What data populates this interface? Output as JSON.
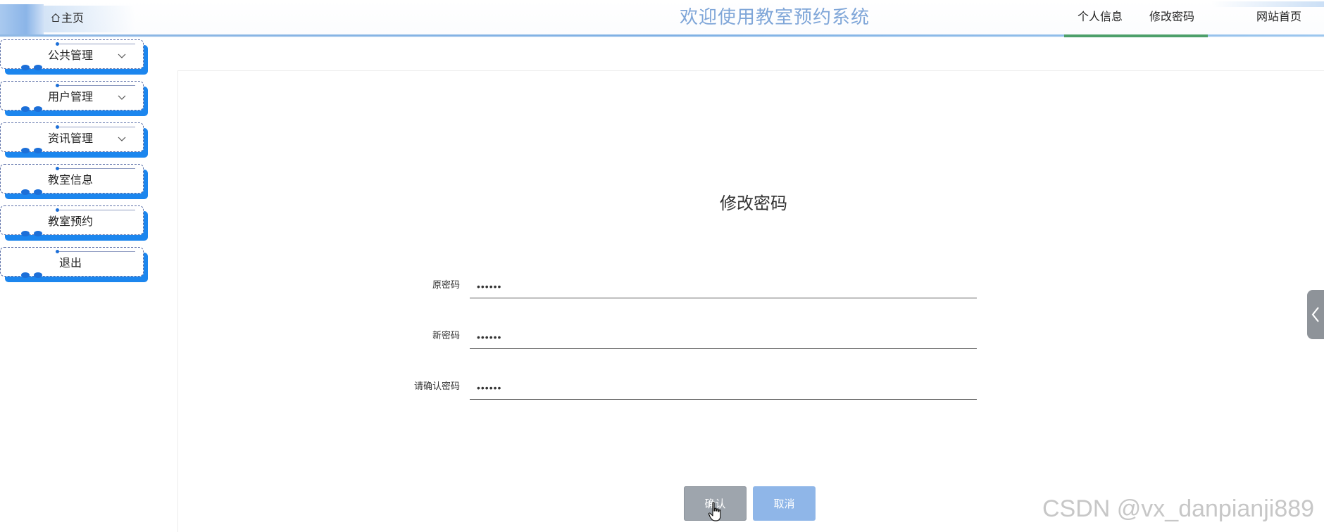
{
  "header": {
    "home_label": "主页",
    "app_title": "欢迎使用教室预约系统",
    "links": [
      "个人信息",
      "修改密码",
      "网站首页"
    ]
  },
  "sidebar": {
    "items": [
      {
        "label": "公共管理",
        "has_submenu": true
      },
      {
        "label": "用户管理",
        "has_submenu": true
      },
      {
        "label": "资讯管理",
        "has_submenu": true
      },
      {
        "label": "教室信息",
        "has_submenu": false
      },
      {
        "label": "教室预约",
        "has_submenu": false
      },
      {
        "label": "退出",
        "has_submenu": false
      }
    ]
  },
  "form": {
    "title": "修改密码",
    "fields": [
      {
        "label": "原密码",
        "value": "••••••"
      },
      {
        "label": "新密码",
        "value": "••••••"
      },
      {
        "label": "请确认密码",
        "value": "••••••"
      }
    ],
    "confirm_label": "确认",
    "cancel_label": "取消"
  },
  "watermark": "CSDN @vx_danpianji889",
  "colors": {
    "title_blue": "#7fa6d8",
    "sidebar_accent": "#1c86ee",
    "active_underline": "#4d9f6a",
    "confirm_button": "#9ea5ad",
    "cancel_button": "#8fb6e8"
  },
  "icons": [
    "home-icon",
    "chevron-down-icon",
    "chevron-left-icon",
    "pointer-cursor-icon"
  ]
}
